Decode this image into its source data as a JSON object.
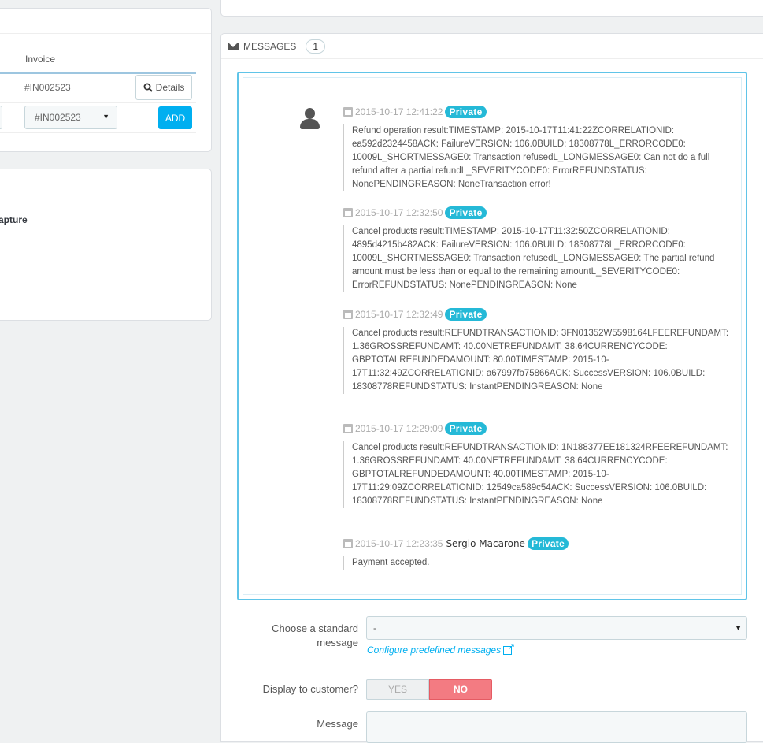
{
  "invoice_panel": {
    "column_header": "Invoice",
    "invoice_number": "#IN002523",
    "details_label": "Details",
    "selected_invoice": "#IN002523",
    "add_label": "ADD"
  },
  "payment_panel": {
    "label_fragment": "apture"
  },
  "messages": {
    "header_label": "MESSAGES",
    "count": "1",
    "items": [
      {
        "timestamp": "2015-10-17 12:41:22",
        "author": "",
        "badge": "Private",
        "body": "Refund operation result:TIMESTAMP: 2015-10-17T11:41:22ZCORRELATIONID: ea592d2324458ACK: FailureVERSION: 106.0BUILD: 18308778L_ERRORCODE0: 10009L_SHORTMESSAGE0: Transaction refusedL_LONGMESSAGE0: Can not do a full refund after a partial refundL_SEVERITYCODE0: ErrorREFUNDSTATUS: NonePENDINGREASON: NoneTransaction error!"
      },
      {
        "timestamp": "2015-10-17 12:32:50",
        "author": "",
        "badge": "Private",
        "body": "Cancel products result:TIMESTAMP: 2015-10-17T11:32:50ZCORRELATIONID: 4895d4215b482ACK: FailureVERSION: 106.0BUILD: 18308778L_ERRORCODE0: 10009L_SHORTMESSAGE0: Transaction refusedL_LONGMESSAGE0: The partial refund amount must be less than or equal to the remaining amountL_SEVERITYCODE0: ErrorREFUNDSTATUS: NonePENDINGREASON: None"
      },
      {
        "timestamp": "2015-10-17 12:32:49",
        "author": "",
        "badge": "Private",
        "body": "Cancel products result:REFUNDTRANSACTIONID: 3FN01352W5598164LFEEREFUNDAMT: 1.36GROSSREFUNDAMT: 40.00NETREFUNDAMT: 38.64CURRENCYCODE: GBPTOTALREFUNDEDAMOUNT: 80.00TIMESTAMP: 2015-10-17T11:32:49ZCORRELATIONID: a67997fb75866ACK: SuccessVERSION: 106.0BUILD: 18308778REFUNDSTATUS: InstantPENDINGREASON: None"
      },
      {
        "timestamp": "2015-10-17 12:29:09",
        "author": "",
        "badge": "Private",
        "body": "Cancel products result:REFUNDTRANSACTIONID: 1N188377EE181324RFEEREFUNDAMT: 1.36GROSSREFUNDAMT: 40.00NETREFUNDAMT: 38.64CURRENCYCODE: GBPTOTALREFUNDEDAMOUNT: 40.00TIMESTAMP: 2015-10-17T11:29:09ZCORRELATIONID: 12549ca589c54ACK: SuccessVERSION: 106.0BUILD: 18308778REFUNDSTATUS: InstantPENDINGREASON: None"
      },
      {
        "timestamp": "2015-10-17 12:23:35",
        "author": "Sergio Macarone",
        "badge": "Private",
        "body": "Payment accepted."
      }
    ]
  },
  "form": {
    "standard_message_label": "Choose a standard message",
    "standard_message_value": "-",
    "configure_link": "Configure predefined messages",
    "display_label": "Display to customer?",
    "yes_label": "YES",
    "no_label": "NO",
    "display_value": "NO",
    "message_label": "Message"
  },
  "colors": {
    "accent": "#00aff0",
    "badge": "#25b9d7",
    "toggle_no": "#f37b82"
  }
}
